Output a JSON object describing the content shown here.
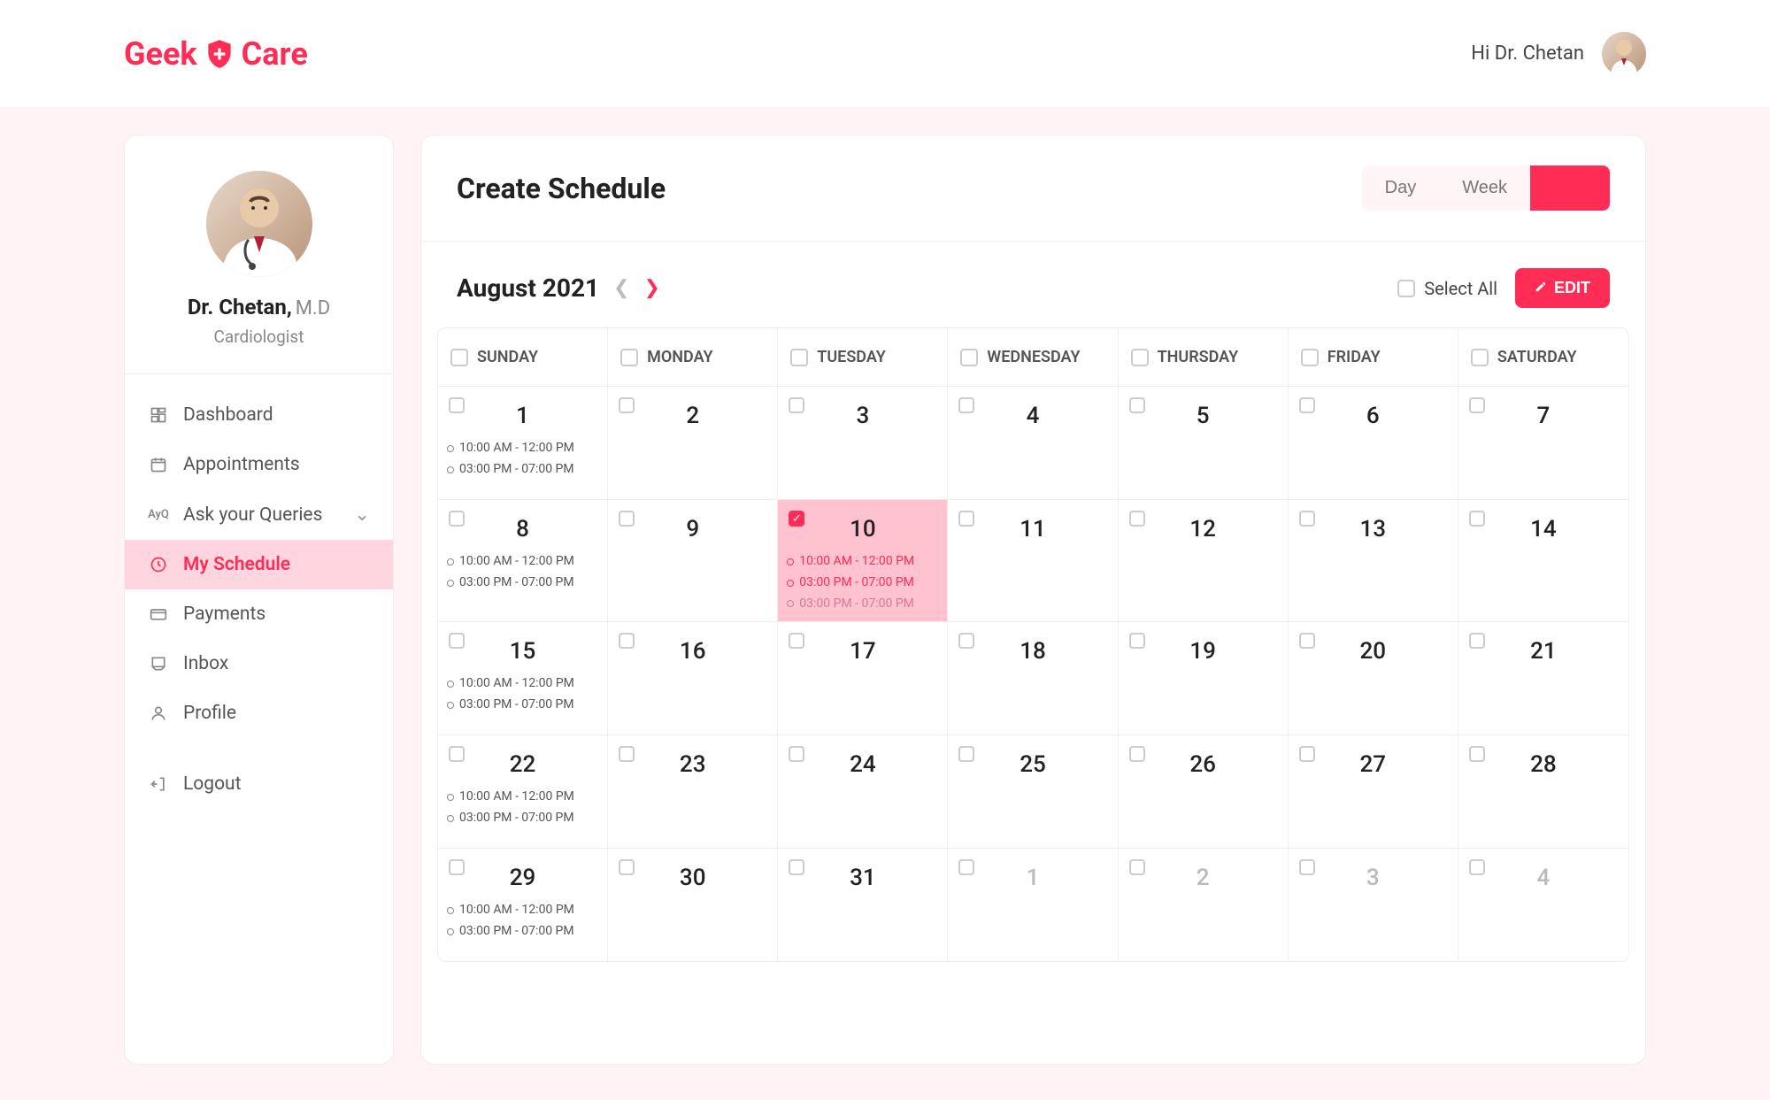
{
  "brand": {
    "geek": "Geek",
    "care": "Care"
  },
  "header": {
    "greeting": "Hi Dr. Chetan"
  },
  "profile": {
    "name": "Dr. Chetan,",
    "degree": "M.D",
    "specialty": "Cardiologist"
  },
  "nav": {
    "dashboard": "Dashboard",
    "appointments": "Appointments",
    "ask_your_queries": "Ask your Queries",
    "my_schedule": "My Schedule",
    "payments": "Payments",
    "inbox": "Inbox",
    "profile": "Profile",
    "logout": "Logout"
  },
  "page": {
    "title": "Create Schedule",
    "views": {
      "day": "Day",
      "week": "Week",
      "month": ""
    },
    "month_label": "August 2021",
    "select_all": "Select All",
    "edit": "EDIT"
  },
  "weekdays": [
    "SUNDAY",
    "MONDAY",
    "TUESDAY",
    "WEDNESDAY",
    "THURSDAY",
    "FRIDAY",
    "SATURDAY"
  ],
  "slots": {
    "a": "10:00 AM - 12:00 PM",
    "b": "03:00 PM - 07:00 PM",
    "c": "03:00 PM - 07:00 PM"
  },
  "cells": [
    [
      {
        "d": "1",
        "ev": [
          "a",
          "b"
        ]
      },
      {
        "d": "2"
      },
      {
        "d": "3"
      },
      {
        "d": "4"
      },
      {
        "d": "5"
      },
      {
        "d": "6"
      },
      {
        "d": "7"
      }
    ],
    [
      {
        "d": "8",
        "ev": [
          "a",
          "b"
        ]
      },
      {
        "d": "9"
      },
      {
        "d": "10",
        "sel": true,
        "ev": [
          "a",
          "b",
          "c"
        ]
      },
      {
        "d": "11"
      },
      {
        "d": "12"
      },
      {
        "d": "13"
      },
      {
        "d": "14"
      }
    ],
    [
      {
        "d": "15",
        "ev": [
          "a",
          "b"
        ]
      },
      {
        "d": "16"
      },
      {
        "d": "17"
      },
      {
        "d": "18"
      },
      {
        "d": "19"
      },
      {
        "d": "20"
      },
      {
        "d": "21"
      }
    ],
    [
      {
        "d": "22",
        "ev": [
          "a",
          "b"
        ]
      },
      {
        "d": "23"
      },
      {
        "d": "24"
      },
      {
        "d": "25"
      },
      {
        "d": "26"
      },
      {
        "d": "27"
      },
      {
        "d": "28"
      }
    ],
    [
      {
        "d": "29",
        "ev": [
          "a",
          "b"
        ]
      },
      {
        "d": "30"
      },
      {
        "d": "31"
      },
      {
        "d": "1",
        "other": true
      },
      {
        "d": "2",
        "other": true
      },
      {
        "d": "3",
        "other": true
      },
      {
        "d": "4",
        "other": true
      }
    ]
  ]
}
